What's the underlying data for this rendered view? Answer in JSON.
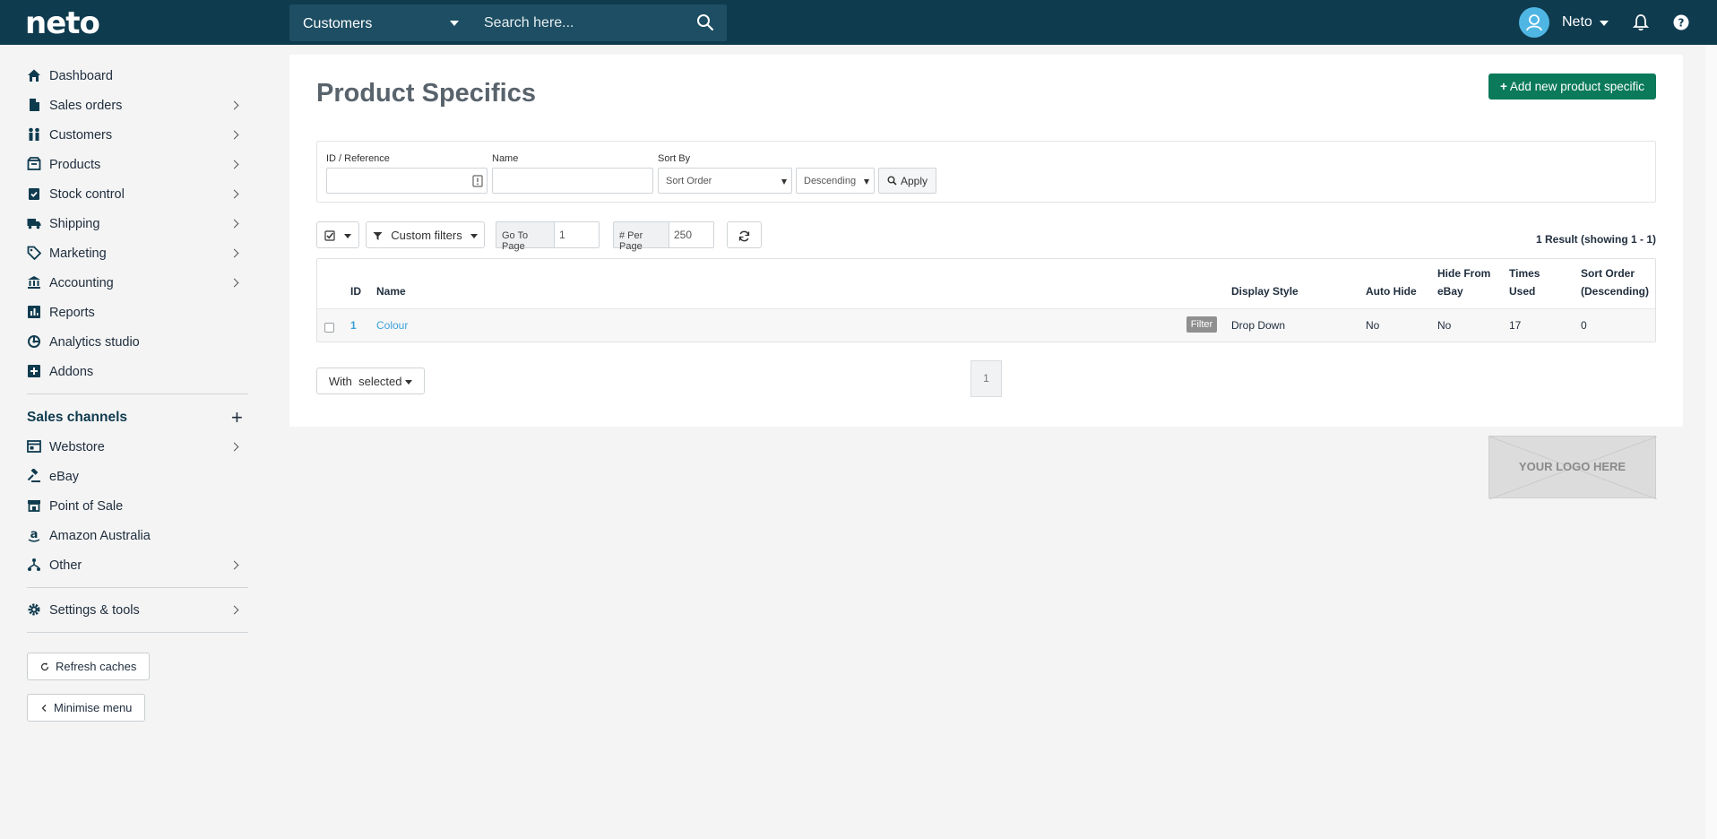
{
  "topbar": {
    "logo": "neto",
    "search_scope": "Customers",
    "search_placeholder": "Search here...",
    "user_name": "Neto"
  },
  "sidebar": {
    "items": [
      {
        "label": "Dashboard",
        "icon": "home-icon",
        "has_chevron": false
      },
      {
        "label": "Sales orders",
        "icon": "document-icon",
        "has_chevron": true
      },
      {
        "label": "Customers",
        "icon": "people-icon",
        "has_chevron": true
      },
      {
        "label": "Products",
        "icon": "box-icon",
        "has_chevron": true
      },
      {
        "label": "Stock control",
        "icon": "clipboard-check-icon",
        "has_chevron": true
      },
      {
        "label": "Shipping",
        "icon": "truck-icon",
        "has_chevron": true
      },
      {
        "label": "Marketing",
        "icon": "tag-icon",
        "has_chevron": true
      },
      {
        "label": "Accounting",
        "icon": "bank-icon",
        "has_chevron": true
      },
      {
        "label": "Reports",
        "icon": "bar-chart-icon",
        "has_chevron": false
      },
      {
        "label": "Analytics studio",
        "icon": "analytics-icon",
        "has_chevron": false
      },
      {
        "label": "Addons",
        "icon": "plus-square-icon",
        "has_chevron": false
      }
    ],
    "sales_channels_title": "Sales channels",
    "channels": [
      {
        "label": "Webstore",
        "icon": "webstore-icon",
        "has_chevron": true
      },
      {
        "label": "eBay",
        "icon": "gavel-icon",
        "has_chevron": false
      },
      {
        "label": "Point of Sale",
        "icon": "store-icon",
        "has_chevron": false
      },
      {
        "label": "Amazon Australia",
        "icon": "amazon-icon",
        "has_chevron": false
      },
      {
        "label": "Other",
        "icon": "network-icon",
        "has_chevron": true
      }
    ],
    "settings_label": "Settings & tools",
    "refresh_caches": "Refresh caches",
    "minimise_menu": "Minimise menu"
  },
  "page": {
    "title": "Product Specifics",
    "add_button": "Add new product specific"
  },
  "filters": {
    "id_label": "ID / Reference",
    "name_label": "Name",
    "sort_by_label": "Sort By",
    "sort_by_value": "Sort Order",
    "direction_value": "Descending",
    "apply": "Apply"
  },
  "toolbar": {
    "custom_filters": "Custom filters",
    "go_to_page_label": "Go To Page",
    "go_to_page_value": "1",
    "per_page_label": "# Per Page",
    "per_page_value": "250",
    "result_count": "1 Result (showing 1 - 1)"
  },
  "table": {
    "headers": {
      "id": "ID",
      "name": "Name",
      "display_style": "Display Style",
      "auto_hide": "Auto Hide",
      "hide_from_ebay_1": "Hide From",
      "hide_from_ebay_2": "eBay",
      "times_used_1": "Times",
      "times_used_2": "Used",
      "sort_order_1": "Sort Order",
      "sort_order_2": "(Descending)"
    },
    "rows": [
      {
        "id": "1",
        "name": "Colour",
        "badge": "Filter",
        "display_style": "Drop Down",
        "auto_hide": "No",
        "hide_from_ebay": "No",
        "times_used": "17",
        "sort_order": "0"
      }
    ]
  },
  "footer": {
    "with_selected": "With  selected",
    "page_number": "1",
    "logo_placeholder": "YOUR LOGO HERE"
  },
  "colors": {
    "topbar": "#0f3b4f",
    "primary_button": "#0b7a5a",
    "link": "#3aa0d8"
  }
}
